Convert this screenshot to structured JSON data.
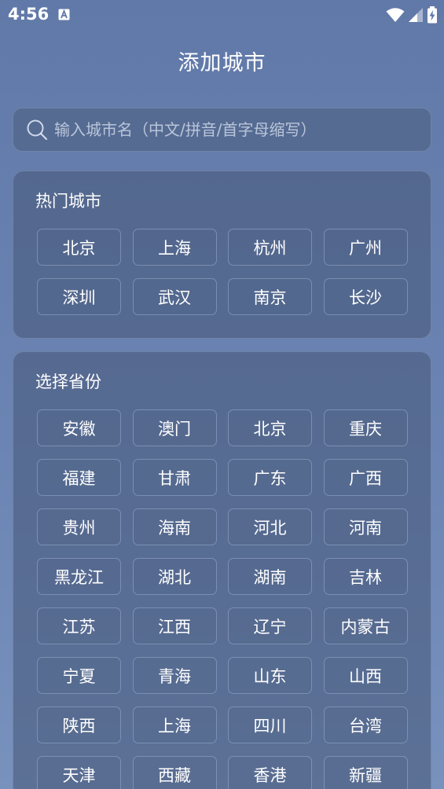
{
  "status_bar": {
    "time": "4:56",
    "notification_icon": "a-letter-icon",
    "wifi_icon": "wifi-icon",
    "signal_icon": "signal-icon",
    "battery_icon": "battery-charging-icon"
  },
  "header": {
    "title": "添加城市"
  },
  "search": {
    "placeholder": "输入城市名（中文/拼音/首字母缩写）",
    "value": "",
    "icon": "search-icon"
  },
  "hot_cities": {
    "title": "热门城市",
    "items": [
      "北京",
      "上海",
      "杭州",
      "广州",
      "深圳",
      "武汉",
      "南京",
      "长沙"
    ]
  },
  "provinces": {
    "title": "选择省份",
    "items": [
      "安徽",
      "澳门",
      "北京",
      "重庆",
      "福建",
      "甘肃",
      "广东",
      "广西",
      "贵州",
      "海南",
      "河北",
      "河南",
      "黑龙江",
      "湖北",
      "湖南",
      "吉林",
      "江苏",
      "江西",
      "辽宁",
      "内蒙古",
      "宁夏",
      "青海",
      "山东",
      "山西",
      "陕西",
      "上海",
      "四川",
      "台湾",
      "天津",
      "西藏",
      "香港",
      "新疆"
    ]
  },
  "colors": {
    "background_top": "#6179a8",
    "background_bottom": "#7891bd",
    "text": "#ffffff"
  }
}
